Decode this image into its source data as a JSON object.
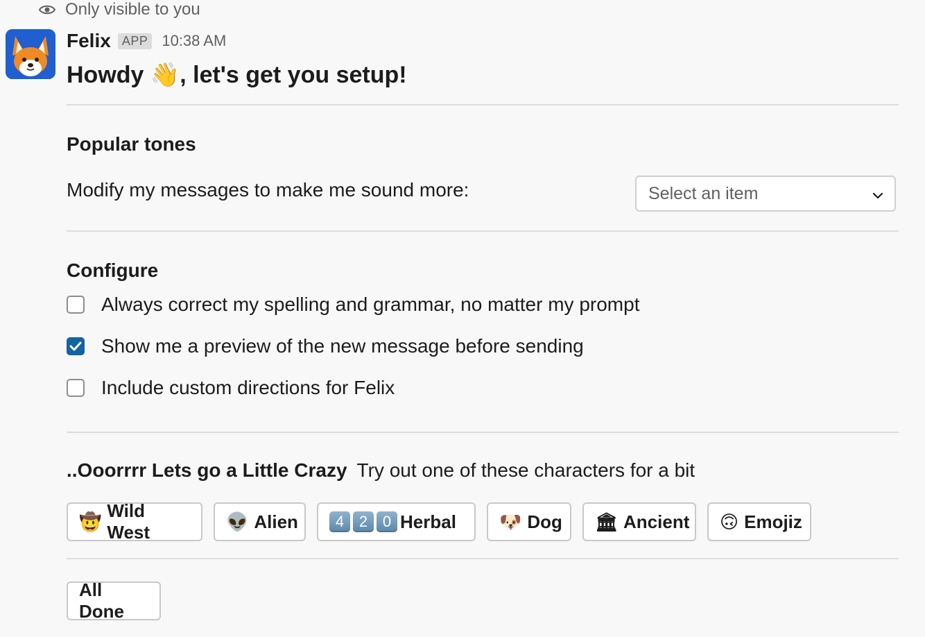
{
  "visibility_note": "Only visible to you",
  "message": {
    "sender": "Felix",
    "app_badge": "APP",
    "time": "10:38 AM",
    "title": "Howdy 👋, let's get you setup!"
  },
  "tones": {
    "heading": "Popular tones",
    "prompt": "Modify my messages to make me sound more:",
    "select_placeholder": "Select an item"
  },
  "configure": {
    "heading": "Configure",
    "options": [
      {
        "label": "Always correct my spelling and grammar, no matter my prompt",
        "checked": false
      },
      {
        "label": "Show me a preview of the new message before sending",
        "checked": true
      },
      {
        "label": "Include custom directions for Felix",
        "checked": false
      }
    ]
  },
  "crazy": {
    "heading": "..Ooorrrr Lets go a Little Crazy",
    "subtext": "Try out one of these characters for a bit",
    "buttons": [
      {
        "emoji": "🤠",
        "label": "Wild West"
      },
      {
        "emoji": "👽",
        "label": "Alien"
      },
      {
        "keys": [
          "4",
          "2",
          "0"
        ],
        "label": "Herbal"
      },
      {
        "emoji": "🐶",
        "label": "Dog"
      },
      {
        "emoji": "🏛",
        "label": "Ancient"
      },
      {
        "emoji": "🙃",
        "label": "Emojiz"
      }
    ]
  },
  "done_button": "All Done",
  "colors": {
    "checkbox_checked": "#1264a3",
    "avatar_bg": "#1f5fd1"
  }
}
